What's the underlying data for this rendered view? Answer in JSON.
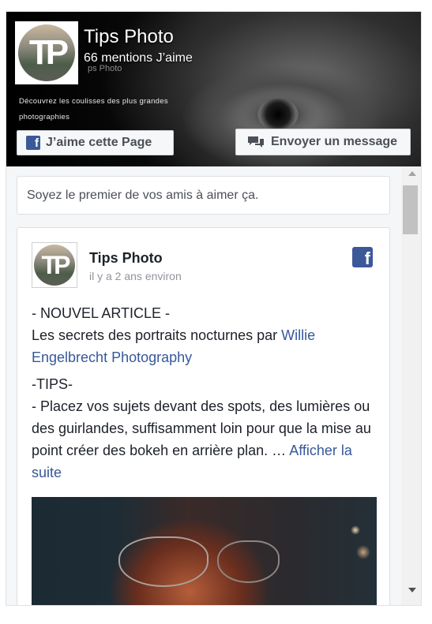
{
  "page": {
    "name": "Tips Photo",
    "likes": "66 mentions J’aime",
    "tagline": "ps Photo",
    "description": "Découvrez les coulisses des plus grandes photographies",
    "logo_text": "TP"
  },
  "buttons": {
    "like": "J’aime cette Page",
    "message": "Envoyer un message"
  },
  "friends_prompt": "Soyez le premier de vos amis à aimer ça.",
  "post": {
    "author": "Tips Photo",
    "time": "il y a 2 ans environ",
    "line1": "- NOUVEL ARTICLE -",
    "line2_prefix": "Les secrets des portraits nocturnes par ",
    "line2_link": "Willie Engelbrecht Photography",
    "line3": "-TIPS-",
    "line4_prefix": "- Placez vos sujets devant des spots, des lumières ou des guirlandes, suffisamment loin pour que la mise au point créer des bokeh en arrière plan. … ",
    "see_more": "Afficher la suite"
  },
  "icons": {
    "facebook": "f"
  },
  "colors": {
    "facebook_blue": "#3b5998",
    "link": "#365899",
    "text": "#1d2129",
    "muted": "#90949c"
  }
}
